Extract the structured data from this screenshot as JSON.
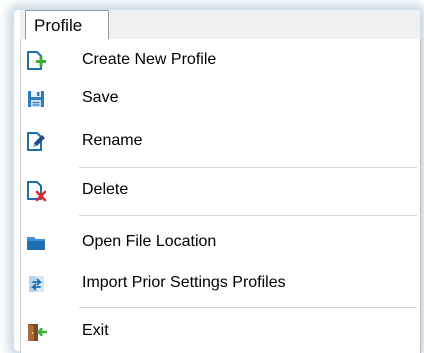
{
  "menubar": {
    "title": "Profile"
  },
  "menu": {
    "items": [
      {
        "label": "Create New Profile",
        "icon": "create-new-icon"
      },
      {
        "label": "Save",
        "icon": "save-icon"
      },
      {
        "label": "Rename",
        "icon": "rename-icon"
      },
      {
        "label": "Delete",
        "icon": "delete-icon"
      },
      {
        "label": "Open File Location",
        "icon": "folder-icon"
      },
      {
        "label": "Import Prior Settings Profiles",
        "icon": "import-icon"
      },
      {
        "label": "Exit",
        "icon": "exit-icon"
      }
    ]
  },
  "colors": {
    "green_accent": "#3cae3c",
    "red_accent": "#e0262a",
    "blue_accent": "#1f6fb0",
    "folder_blue": "#3d8ede"
  }
}
